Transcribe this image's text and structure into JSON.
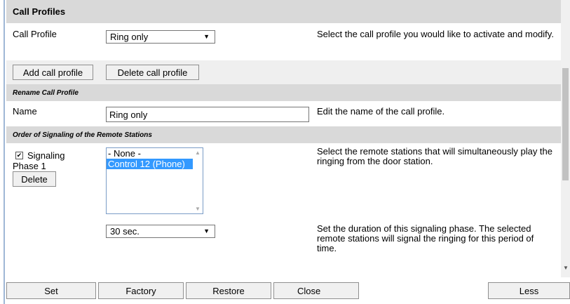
{
  "call_profiles": {
    "title": "Call Profiles",
    "profile_label": "Call Profile",
    "profile_value": "Ring only",
    "profile_help": "Select the call profile you would like to activate and modify.",
    "add_button": "Add call profile",
    "delete_button": "Delete call profile"
  },
  "rename": {
    "title": "Rename Call Profile",
    "name_label": "Name",
    "name_value": "Ring only",
    "name_help": "Edit the name of the call profile."
  },
  "order": {
    "title": "Order of Signaling of the Remote Stations",
    "phase_checked": true,
    "phase_label_1": "Signaling",
    "phase_label_2": "Phase 1",
    "delete_button": "Delete",
    "stations": [
      {
        "label": "- None -",
        "selected": false
      },
      {
        "label": "Control 12   (Phone)",
        "selected": true
      }
    ],
    "stations_help": "Select the remote stations that will simultaneously play the ringing from the door station.",
    "duration_value": "30 sec.",
    "duration_help": "Set the duration of this signaling phase. The selected remote stations will signal the ringing for this period of time."
  },
  "footer": {
    "set": "Set",
    "factory": "Factory",
    "restore": "Restore",
    "close": "Close",
    "less": "Less"
  }
}
